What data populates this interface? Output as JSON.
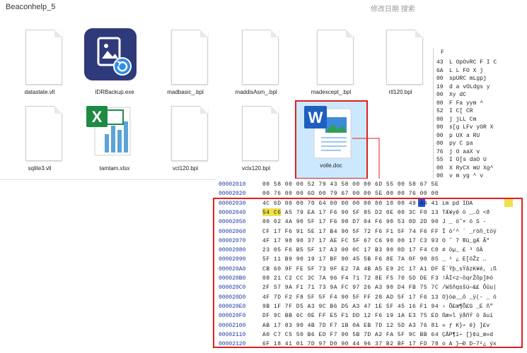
{
  "window": {
    "title": "Beaconhelp_5",
    "corner_text": "修改日期 搜索"
  },
  "files": [
    {
      "name": "datastate.vll",
      "icon": "blank-document-icon"
    },
    {
      "name": "IDRBackup.exe",
      "icon": "app-restore-icon"
    },
    {
      "name": "madbasic_.bpl",
      "icon": "blank-document-icon"
    },
    {
      "name": "maddisAsm_.bpl",
      "icon": "blank-document-icon"
    },
    {
      "name": "madexcept_.bpl",
      "icon": "blank-document-icon"
    },
    {
      "name": "rtl120.bpl",
      "icon": "blank-document-icon"
    },
    {
      "name": "sqlite3.vll",
      "icon": "blank-document-icon"
    },
    {
      "name": "tamtam.xlsx",
      "icon": "excel-icon"
    },
    {
      "name": "vcl120.bpl",
      "icon": "blank-document-icon"
    },
    {
      "name": "vclx120.bpl",
      "icon": "blank-document-icon"
    },
    {
      "name": "voile.doc",
      "icon": "word-icon",
      "selected": true
    }
  ],
  "side_header": "F",
  "side_rows": [
    {
      "hex": "43",
      "ascii": "L OpOvRC F I C"
    },
    {
      "hex": "6A",
      "ascii": "L  L FO X j"
    },
    {
      "hex": "00",
      "ascii": "spURC  mLgpj"
    },
    {
      "hex": "19",
      "ascii": "d a vOLdgs  y"
    },
    {
      "hex": "00",
      "ascii": "Xy      dC"
    },
    {
      "hex": "00",
      "ascii": "F  Fa  yym ^"
    },
    {
      "hex": "52",
      "ascii": "     I C[ CR"
    },
    {
      "hex": "00",
      "ascii": "j jLL      Cm"
    },
    {
      "hex": "00",
      "ascii": "s[g LFv    yOR X"
    },
    {
      "hex": "00",
      "ascii": "p UX    a  RU"
    },
    {
      "hex": "00",
      "ascii": "py  C      pa"
    },
    {
      "hex": "76",
      "ascii": "j  O  aaX  v"
    },
    {
      "hex": "55",
      "ascii": "I  O[s  daO U"
    },
    {
      "hex": "00",
      "ascii": "X  RyCX  mU Xg^"
    },
    {
      "hex": "00",
      "ascii": "v  m yg  ^  v"
    }
  ],
  "hex_rows": [
    {
      "addr": "00002010",
      "bytes": "00 58 00 00 52 79 43 58  00 00 6D 55 00 58 67 5E",
      "ascii": ""
    },
    {
      "addr": "00002020",
      "bytes": "00 76 00 00 6D 00 79 67  00 00 5E 00 00 76 00 00",
      "ascii": ""
    },
    {
      "addr": "00002030",
      "bytes": "4C 6D 00 00 70 64 00 00  00 00 00 10 00 49 44 41",
      "ascii": "Lm  pd        IDA"
    },
    {
      "addr": "00002040",
      "bytes": "54 C6 A5 79 EA 17 F6 90  5F 85 D2 0E 00 3C F0 13",
      "ascii": "TÆ¥yê ö _…Ò  <ð"
    },
    {
      "addr": "00002050",
      "bytes": "00 02 4A 90 5F 17 F6 98  D7 04 F6 90 53 0D 2D 90",
      "ascii": "  J  _ ö˜× ö S -"
    },
    {
      "addr": "00002060",
      "bytes": "CF 17 F6 91 5E 17 B4 90  5F 72 F6 F1 5F 74 F6 FF",
      "ascii": "Ï ö‘^ ´ _röñ_töÿ"
    },
    {
      "addr": "00002070",
      "bytes": "4F 17 98 90 37 17 AE FC  5F 67 C6 90 00 17 C3 93",
      "ascii": "O ˜ 7 ®ü_gÆ   Ã“"
    },
    {
      "addr": "00002080",
      "bytes": "23 05 F6 B5 5F 17 A3 90  0C 17 B3 90 0D 17 F4 C0",
      "ascii": "# öµ_ £     ³   ôÀ"
    },
    {
      "addr": "00002090",
      "bytes": "5F 11 B9 90 19 17 BF 90  45 5B F6 8E 7A 0F 90 85",
      "ascii": "_ ¹   ¿ E[öŽz  …"
    },
    {
      "addr": "000020A0",
      "bytes": "CB 60 9F FE 5F 73 9F E2  7A 4B A5 E9 2C 17 A1 DF",
      "ascii": "Ë`Ÿþ_sŸâzK¥é, ¡ß"
    },
    {
      "addr": "000020B0",
      "bytes": "08 21 C2 CC 3C 7A 96 F4  71 72 8E F5 70 5D DE F3",
      "ascii": " !ÂÌ<z–ôqrŽõp]Þó"
    },
    {
      "addr": "000020C0",
      "bytes": "2F 57 9A F1 71 73 9A FC  97 26 A3 90 D4 FB 75 7C",
      "ascii": "/Wšñqsšü—&£ Ôûu|"
    },
    {
      "addr": "000020D0",
      "bytes": "4F 7D F2 F8 5F 5F F4 90  5F FF 28 AD 5F 17 F6 13",
      "ascii": "O}òø__ô _ÿ(- _ ö"
    },
    {
      "addr": "000020E0",
      "bytes": "9B 1F 7F D5 A3 9C B6 D5  A3 47 1E 5F 45 16 F1 94",
      "ascii": "›  Õ£œ¶Õ£G _E ñ”"
    },
    {
      "addr": "000020F0",
      "bytes": "DF 9C BB 6C 0E FF E5 F1  DD 12 F6 19 1A E3 75 ED",
      "ascii": "ßœ»l ÿåñÝ ö  ãuí"
    },
    {
      "addr": "00002100",
      "bytes": "AB 17 83 90 4B 7D F7 1B  0A EB 7D 12 5D A3 76 81",
      "ascii": "« ƒ K}÷  ë} ]£v"
    },
    {
      "addr": "00002110",
      "bytes": "A0 C7 C5 50 B6 ED F7 90  5B 7D A2 FA 5F 9C BB 64",
      "ascii": " ÇÅP¶í÷ [}¢ú_œ»d"
    },
    {
      "addr": "00002120",
      "bytes": "6F 18 41 01 7D 97 D0 90  44 96 37 B2 BF 17 FD 78",
      "ascii": "o A }—Ð D–7²¿ ýx"
    }
  ],
  "colors": {
    "highlight_frame": "#e02020",
    "address": "#1a3aa0",
    "selection": "#cce8ff",
    "cursor": "#1e4fd6",
    "signature": "#f2e04a"
  }
}
